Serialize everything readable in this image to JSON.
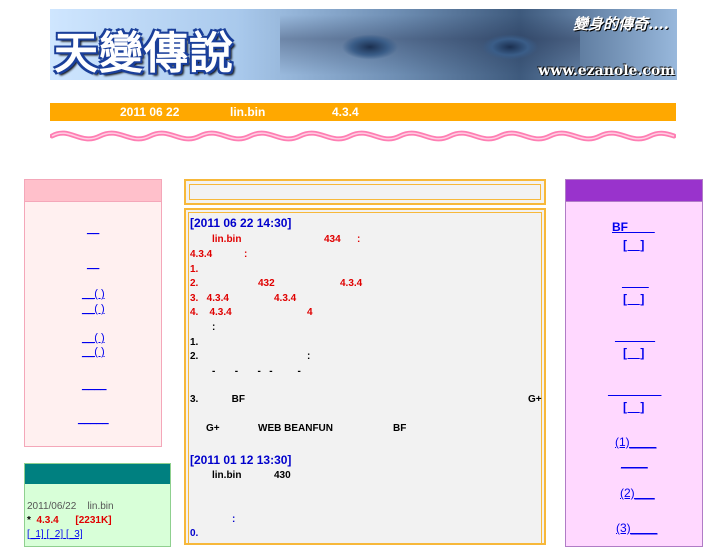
{
  "banner": {
    "logo_text": "天變傳說",
    "slogan": "變身的傳奇....",
    "url": "www.ezanole.com"
  },
  "infobar": {
    "date": "2011  06  22",
    "author": "lin.bin",
    "version": "4.3.4"
  },
  "left_menu": {
    "links": [
      "__",
      "__",
      "__( )",
      "__( )",
      "__( )",
      "__( )",
      "____",
      "_____"
    ]
  },
  "left_box2": {
    "date": "2011/06/22",
    "user": "lin.bin",
    "bullet": "*",
    "version": "4.3.4",
    "size": "[2231K]",
    "pages": [
      "[_1]",
      "[_2]",
      "[_3]"
    ]
  },
  "news": [
    {
      "title": "[2011  06  22   14:30]",
      "lines": [
        {
          "text": "lin.bin",
          "extra": "434",
          "tail": ":",
          "color": "red"
        },
        {
          "text": "4.3.4",
          "tail": ":",
          "color": "red"
        },
        {
          "text": "1.",
          "color": "red"
        },
        {
          "text": "2.",
          "extra": "432",
          "extra2": "4.3.4",
          "color": "red"
        },
        {
          "text": "3.   4.3.4",
          "extra": "4.3.4",
          "color": "red"
        },
        {
          "text": "4.    4.3.4",
          "extra": "4",
          "color": "red"
        },
        {
          "text": ":",
          "color": "black"
        },
        {
          "text": "1.",
          "color": "black"
        },
        {
          "text": "2.",
          "tail": ":",
          "color": "black"
        },
        {
          "text": "-       -       -   -         -",
          "color": "black"
        },
        {
          "text": "3.            BF",
          "tail": "G+",
          "color": "black"
        },
        {
          "text": "G+",
          "extra": "WEB BEANFUN",
          "extra2": "BF",
          "color": "black"
        }
      ]
    },
    {
      "title": "[2011  01  12   13:30]",
      "lines": [
        {
          "text": "lin.bin",
          "extra": "430",
          "color": "black"
        },
        {
          "text": ":",
          "color": "blue"
        },
        {
          "text": "0.",
          "color": "blue"
        }
      ]
    }
  ],
  "right_menu": {
    "links": [
      "BF____",
      "[__]",
      "____",
      "[__]",
      "______",
      "[__]",
      "________",
      "[__]",
      "(1)____",
      "____",
      "(2)___",
      "(3)____"
    ]
  },
  "colors": {
    "infobar": "#ffa800",
    "left_header": "#ffc0cb",
    "right_header": "#9933cc",
    "left2_header": "#008080",
    "center_border": "#f7b83a",
    "ribbon": "#ff7eb3"
  }
}
